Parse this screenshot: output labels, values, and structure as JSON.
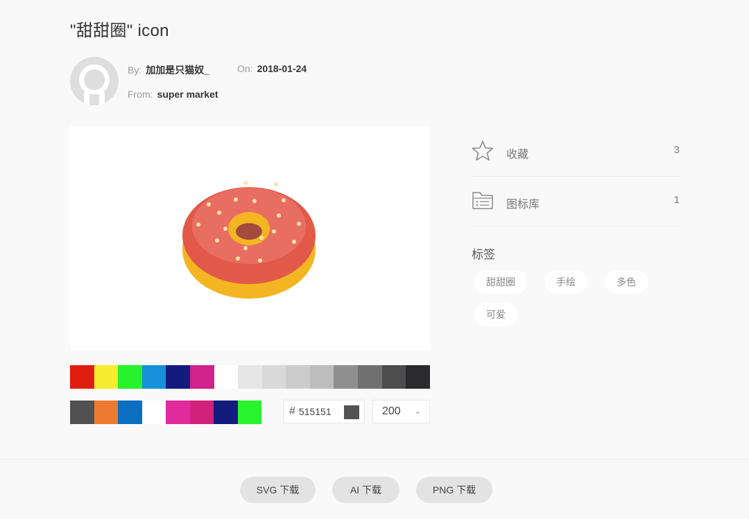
{
  "page": {
    "title": "\"甜甜圈\" icon"
  },
  "author": {
    "by_label": "By:",
    "by_value": "加加是只猫奴_",
    "on_label": "On:",
    "on_value": "2018-01-24",
    "from_label": "From:",
    "from_value": "super market"
  },
  "palette": {
    "row1_colors": [
      "#e01e0f",
      "#f7ec2e",
      "#27f22c",
      "#1592da",
      "#141b7e",
      "#d1218b",
      "#ffffff"
    ],
    "row1_grays": [
      "#e6e6e6",
      "#d9d9d9",
      "#cccccc",
      "#bdbdbd",
      "#8f8f8f",
      "#707070",
      "#4d4d4d",
      "#2b2b2d"
    ],
    "row2_colors": [
      "#515151",
      "#ee7a31",
      "#0a6fc1",
      "#ffffff"
    ],
    "row2_colors_b": [
      "#e12a9c",
      "#d2207d",
      "#131b7c",
      "#27f42d"
    ]
  },
  "controls": {
    "hash": "#",
    "hex_value": "515151",
    "size_value": "200",
    "chevron": "⌄"
  },
  "sidebar": {
    "favorite": {
      "label": "收藏",
      "count": "3"
    },
    "library": {
      "label": "图标库",
      "count": "1"
    },
    "tags_title": "标签",
    "tags": [
      "甜甜圈",
      "手绘",
      "多色",
      "可爱"
    ]
  },
  "downloads": {
    "svg": "SVG 下载",
    "ai": "AI 下载",
    "png": "PNG 下载"
  }
}
